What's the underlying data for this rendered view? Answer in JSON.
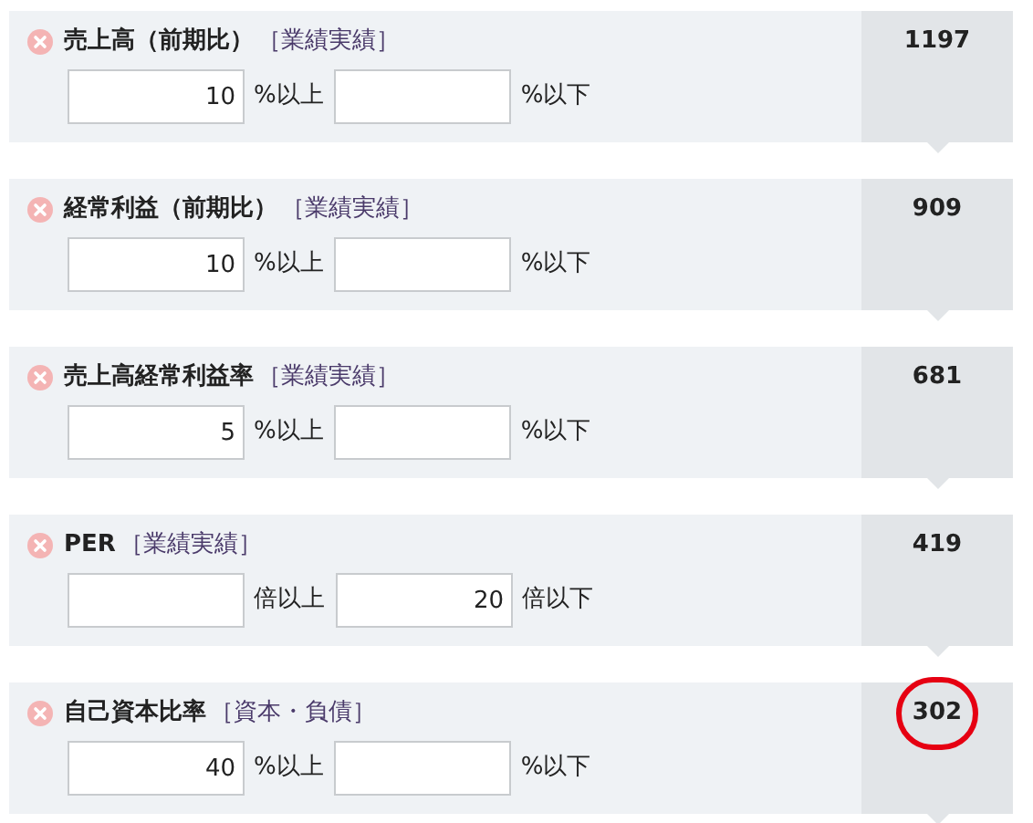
{
  "conditions": [
    {
      "title": "売上高（前期比）",
      "category": "［業績実績］",
      "min": {
        "value": "10",
        "unit": "%以上"
      },
      "max": {
        "unit": "%以下"
      },
      "count": "1197",
      "highlighted": false
    },
    {
      "title": "経常利益（前期比）",
      "category": "［業績実績］",
      "min": {
        "value": "10",
        "unit": "%以上"
      },
      "max": {
        "unit": "%以下"
      },
      "count": "909",
      "highlighted": false
    },
    {
      "title": "売上高経常利益率",
      "category": "［業績実績］",
      "min": {
        "value": "5",
        "unit": "%以上"
      },
      "max": {
        "unit": "%以下"
      },
      "count": "681",
      "highlighted": false
    },
    {
      "title": "PER",
      "category": "［業績実績］",
      "min": {
        "unit": "倍以上"
      },
      "max": {
        "value": "20",
        "unit": "倍以下"
      },
      "count": "419",
      "highlighted": false
    },
    {
      "title": "自己資本比率",
      "category": "［資本・負債］",
      "min": {
        "value": "40",
        "unit": "%以上"
      },
      "max": {
        "unit": "%以下"
      },
      "count": "302",
      "highlighted": true
    }
  ]
}
